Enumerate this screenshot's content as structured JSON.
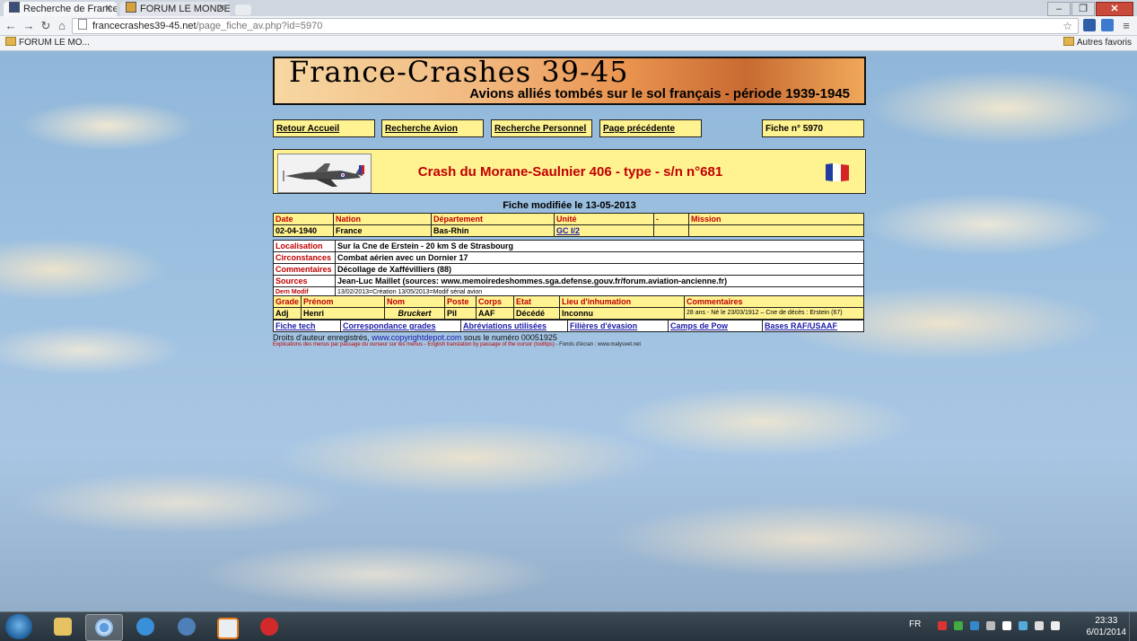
{
  "browser": {
    "tabs": [
      {
        "label": "Recherche de France-Crashes",
        "active": true
      },
      {
        "label": "FORUM LE MONDE DE L'AVIATION",
        "active": false
      }
    ],
    "url_host": "francecrashes39-45.net",
    "url_path": "/page_fiche_av.php?id=5970",
    "bookmarks": [
      "FORUM LE MO..."
    ],
    "other_bookmarks": "Autres favoris"
  },
  "banner": {
    "title": "France-Crashes 39-45",
    "subtitle": "Avions alliés tombés sur le sol français - période 1939-1945"
  },
  "nav": {
    "home": "Retour Accueil",
    "search_plane": "Recherche Avion",
    "search_person": "Recherche Personnel",
    "previous": "Page précédente",
    "fiche_no": "Fiche n° 5970"
  },
  "crash": {
    "title": "Crash du Morane-Saulnier 406 - type - s/n n°681",
    "modified": "Fiche modifiée le 13-05-2013"
  },
  "table1": {
    "headers": [
      "Date",
      "Nation",
      "Département",
      "Unité",
      "-",
      "Mission"
    ],
    "values": [
      "02-04-1940",
      "France",
      "Bas-Rhin",
      "GC I/2",
      "",
      ""
    ]
  },
  "details": {
    "localisation_label": "Localisation",
    "localisation": "Sur la Cne de Erstein - 20 km S de Strasbourg",
    "circonstances_label": "Circonstances",
    "circonstances": "Combat aérien avec un Dornier 17",
    "commentaires_label": "Commentaires",
    "commentaires": "Décollage de Xaffévilliers (88)",
    "sources_label": "Sources",
    "sources": "Jean-Luc Maillet (sources: www.memoiredeshommes.sga.defense.gouv.fr/forum.aviation-ancienne.fr)",
    "dern_modif_label": "Dern Modif",
    "dern_modif": "13/02/2013=Création 13/05/2013=Modif sérial avion"
  },
  "crew": {
    "headers": [
      "Grade",
      "Prénom",
      "Nom",
      "Poste",
      "Corps",
      "Etat",
      "Lieu d'inhumation",
      "Commentaires"
    ],
    "rows": [
      [
        "Adj",
        "Henri",
        "Bruckert",
        "Pil",
        "AAF",
        "Décédé",
        "Inconnu",
        "28 ans - Né le 23/03/1912 – Cne de décès : Erstein (67)"
      ]
    ]
  },
  "footer_links": [
    "Fiche tech",
    "Correspondance grades",
    "Abréviations utilisées",
    "Filières d'évasion",
    "Camps de Pow",
    "Bases RAF/USAAF"
  ],
  "copyright": {
    "prefix": "Droits d'auteur enregistrés,",
    "link": "www.copyrightdepot.com",
    "suffix": "sous le numéro 00051925"
  },
  "explain": {
    "red": "Explications des menus par passage du ourseur sur les menus - English translation by passage of the oursor (tooltips)",
    "black": "- Fonds d'écran : www.malysvet.net"
  },
  "taskbar": {
    "lang": "FR",
    "time": "23:33",
    "date": "6/01/2014"
  },
  "colors": {
    "panel_yellow": "#fff291",
    "accent_red": "#c00000",
    "link_blue": "#1a1aa8"
  }
}
